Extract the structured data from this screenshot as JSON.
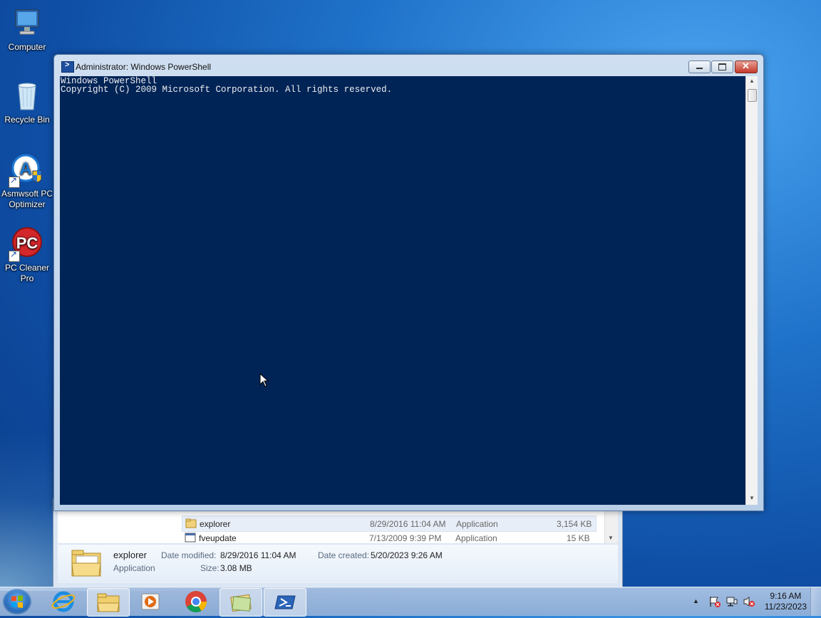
{
  "desktop": {
    "icons": [
      {
        "label": "Computer",
        "icon": "computer-icon"
      },
      {
        "label": "Recycle Bin",
        "icon": "recycle-bin-icon"
      },
      {
        "label": "Asmwsoft PC Optimizer",
        "icon": "asmwsoft-icon"
      },
      {
        "label": "PC Cleaner Pro",
        "icon": "pc-cleaner-icon"
      }
    ]
  },
  "powershell": {
    "title": "Administrator: Windows PowerShell",
    "console_lines": [
      "Windows PowerShell",
      "Copyright (C) 2009 Microsoft Corporation. All rights reserved."
    ],
    "background_color": "#012456"
  },
  "explorer": {
    "rows": [
      {
        "name": "explorer",
        "date": "8/29/2016 11:04 AM",
        "type": "Application",
        "size": "3,154 KB"
      },
      {
        "name": "fveupdate",
        "date": "7/13/2009 9:39 PM",
        "type": "Application",
        "size": "15 KB"
      }
    ],
    "details": {
      "name": "explorer",
      "kind": "Application",
      "modified_label": "Date modified:",
      "modified": "8/29/2016 11:04 AM",
      "created_label": "Date created:",
      "created": "5/20/2023 9:26 AM",
      "size_label": "Size:",
      "size": "3.08 MB"
    }
  },
  "taskbar": {
    "items": [
      "ie-icon",
      "explorer-icon",
      "media-player-icon",
      "chrome-icon",
      "folder-icon",
      "powershell-icon"
    ],
    "clock_time": "9:16 AM",
    "clock_date": "11/23/2023"
  }
}
